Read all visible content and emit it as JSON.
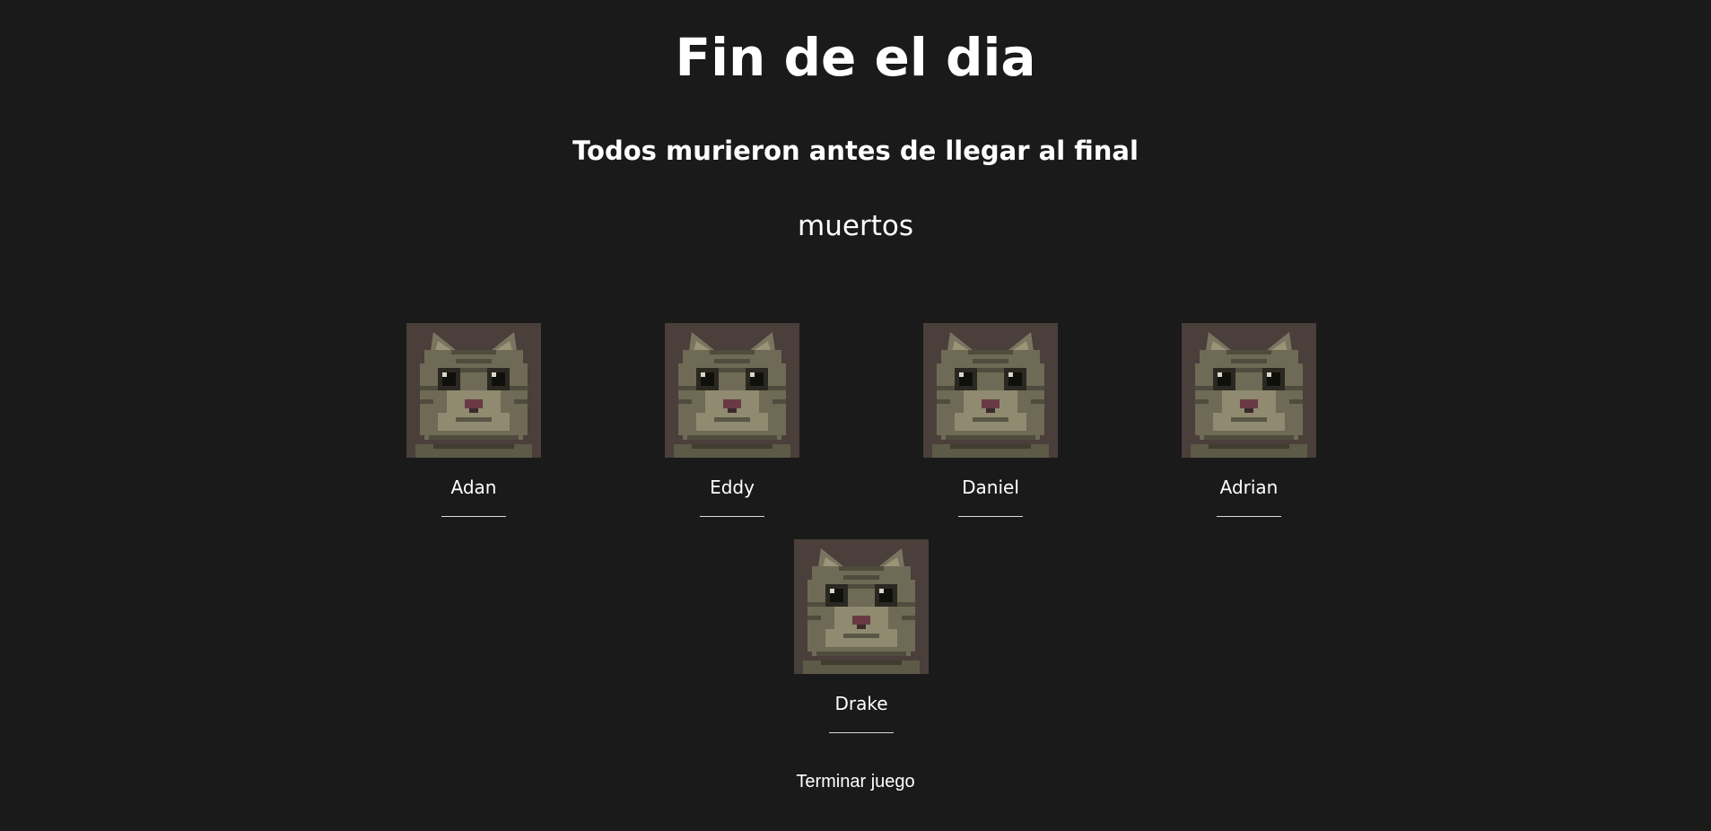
{
  "header": {
    "title": "Fin de el dia",
    "subtitle": "Todos murieron antes de llegar al final"
  },
  "dead_section": {
    "label": "muertos",
    "characters": [
      {
        "name": "Adan",
        "portrait_icon": "cat-portrait-icon"
      },
      {
        "name": "Eddy",
        "portrait_icon": "cat-portrait-icon"
      },
      {
        "name": "Daniel",
        "portrait_icon": "cat-portrait-icon"
      },
      {
        "name": "Adrian",
        "portrait_icon": "cat-portrait-icon"
      },
      {
        "name": "Drake",
        "portrait_icon": "cat-portrait-icon"
      }
    ]
  },
  "actions": {
    "end_game_label": "Terminar juego"
  },
  "colors": {
    "background": "#1a1a1a",
    "text": "#ffffff",
    "portrait_bg": "#4a3f3a"
  }
}
